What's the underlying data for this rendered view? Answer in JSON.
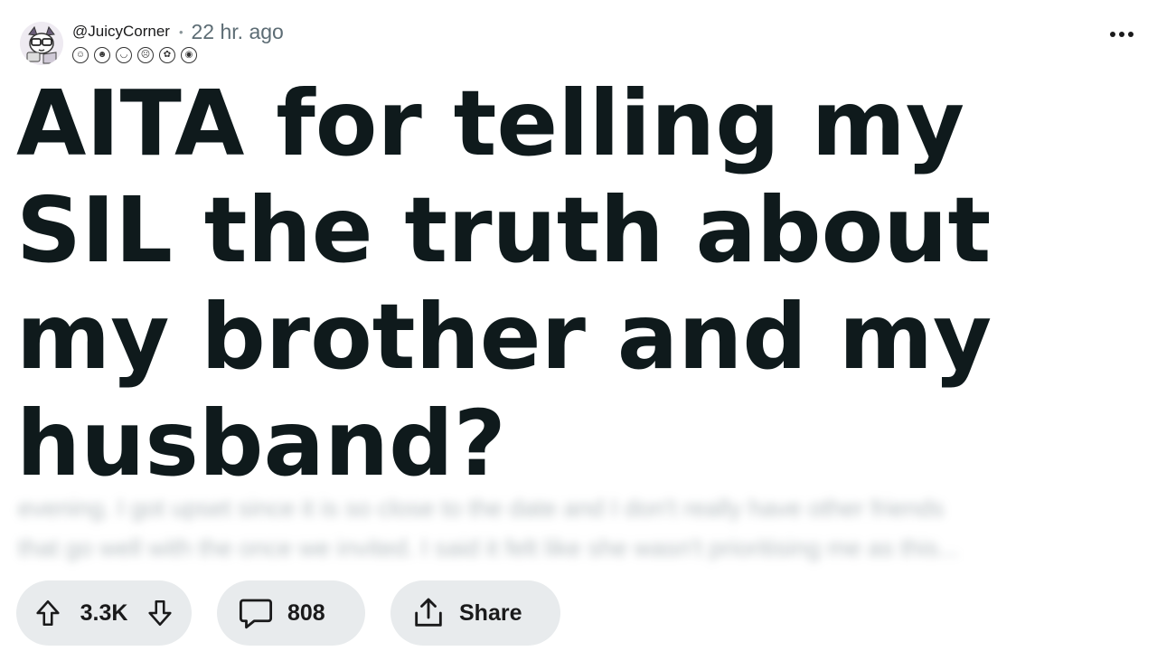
{
  "post": {
    "username": "@JuicyCorner",
    "separator": "•",
    "time_ago": "22 hr. ago",
    "title": "AITA for telling my SIL the truth about my brother and my husband?",
    "preview_lines": [
      "evening. I got upset since it is so close to the date and I don't really have other friends",
      "that go well with the once we invited. I said it felt like she wasn't prioritising me as this..."
    ]
  },
  "awards": [
    "award-1",
    "award-2",
    "award-3",
    "award-4",
    "award-5",
    "award-6"
  ],
  "actions": {
    "vote_count": "3.3K",
    "comment_count": "808",
    "share_label": "Share"
  },
  "colors": {
    "title": "#0f1a1c",
    "pill_bg": "#e8ebed",
    "meta_gray": "#5c6c74"
  }
}
